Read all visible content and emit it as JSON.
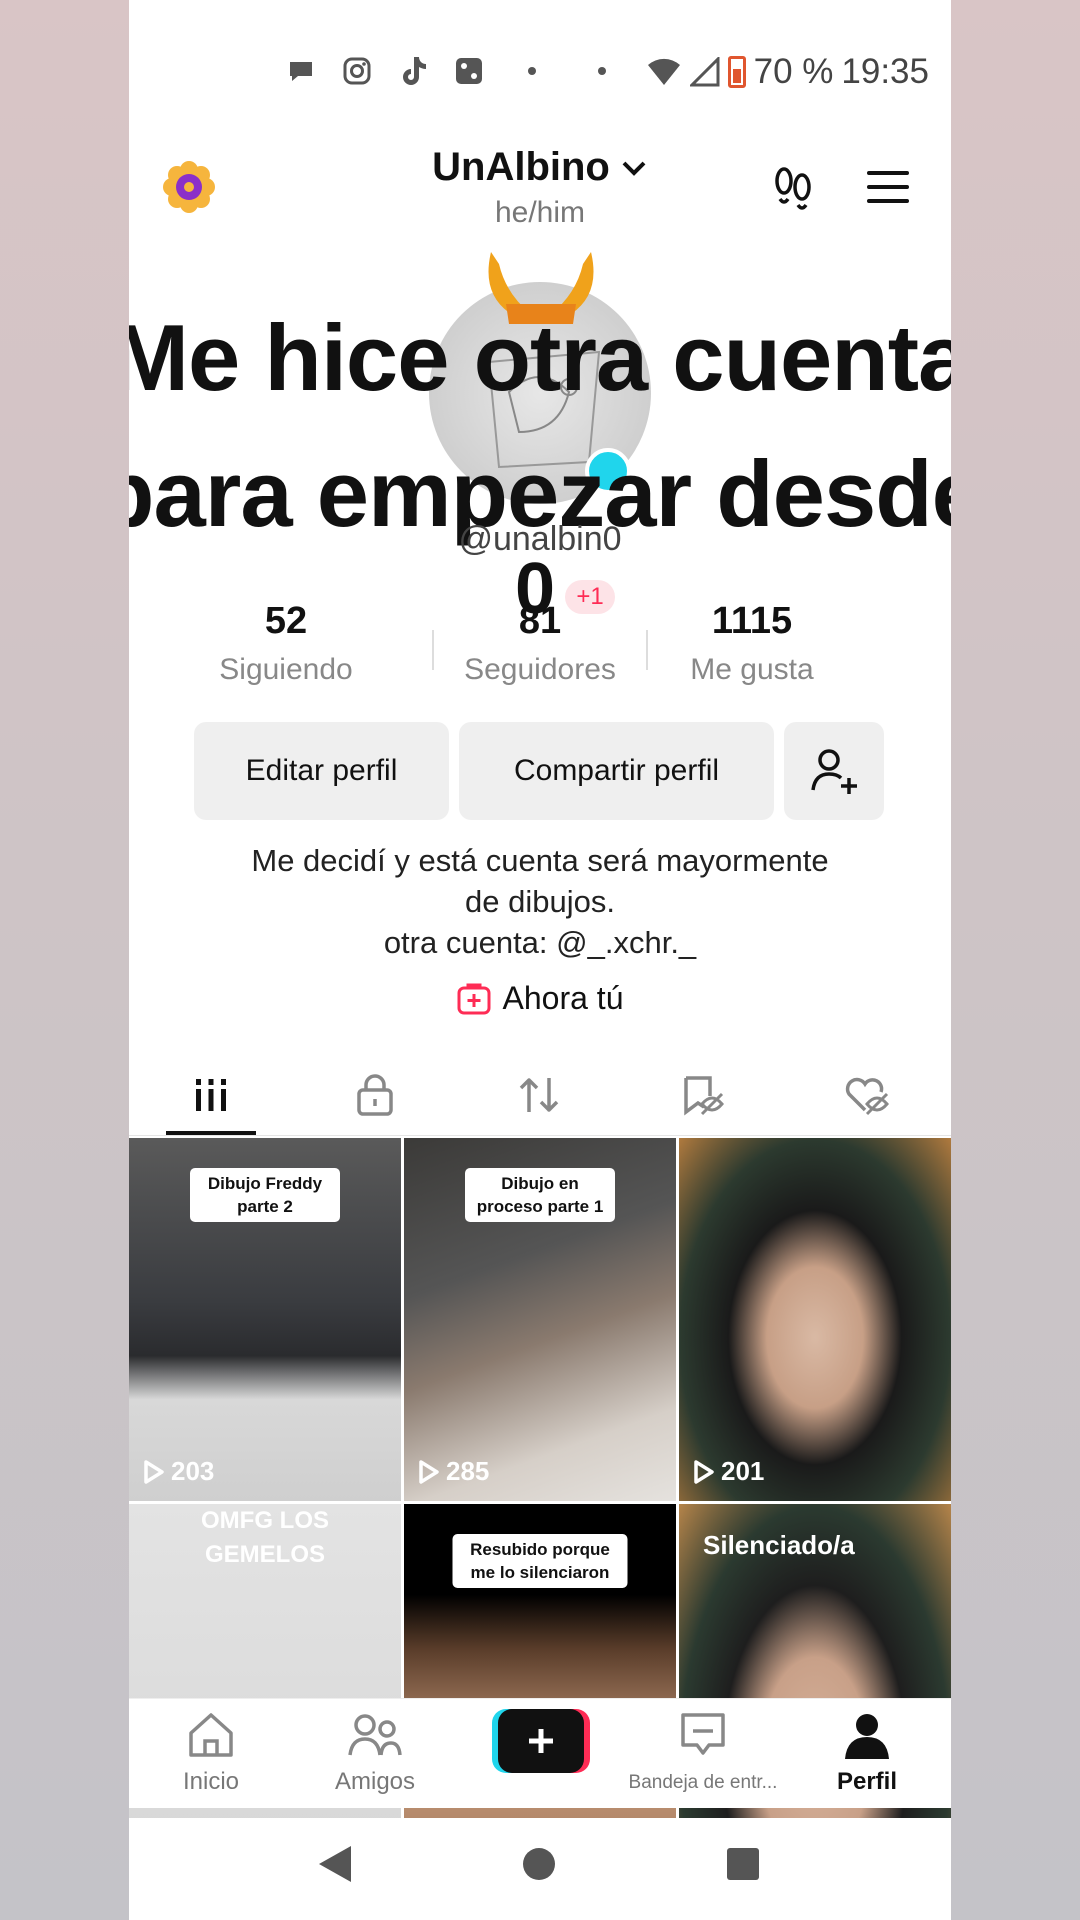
{
  "status_bar": {
    "battery": "70 %",
    "time": "19:35",
    "app_icons": [
      "chat-bubble-icon",
      "instagram-icon",
      "tiktok-icon",
      "photo-icon"
    ]
  },
  "header": {
    "username": "UnAlbino",
    "pronouns": "he/him"
  },
  "overlay": {
    "line1": "Me hice otra cuenta",
    "line2": "para empezar desde",
    "line3": "0"
  },
  "profile": {
    "handle": "@unalbin0",
    "new_followers_badge": "+1"
  },
  "stats": [
    {
      "value": "52",
      "label": "Siguiendo"
    },
    {
      "value": "81",
      "label": "Seguidores"
    },
    {
      "value": "1115",
      "label": "Me gusta"
    }
  ],
  "buttons": {
    "edit": "Editar perfil",
    "share": "Compartir perfil"
  },
  "bio": {
    "line1": "Me decidí y está cuenta será mayormente",
    "line2": "de dibujos.",
    "line3": "otra cuenta: @_.xchr._"
  },
  "cta": "Ahora tú",
  "tabs": [
    "videos-grid-icon",
    "lock-icon",
    "repost-icon",
    "saved-hidden-icon",
    "liked-hidden-icon"
  ],
  "videos": [
    {
      "caption": "Dibujo Freddy parte 2",
      "views": "203"
    },
    {
      "caption": "Dibujo en proceso parte 1",
      "views": "285"
    },
    {
      "caption": "",
      "views": "201"
    },
    {
      "caption": "OMFG LOS GEMELOS",
      "views": ""
    },
    {
      "caption": "Resubido porque me lo silenciaron",
      "views": ""
    },
    {
      "caption": "Silenciado/a",
      "views": ""
    }
  ],
  "nav": {
    "home": "Inicio",
    "friends": "Amigos",
    "inbox": "Bandeja de entr...",
    "profile": "Perfil"
  },
  "colors": {
    "accent_red": "#fe2c55",
    "accent_cyan": "#20d5ec"
  }
}
